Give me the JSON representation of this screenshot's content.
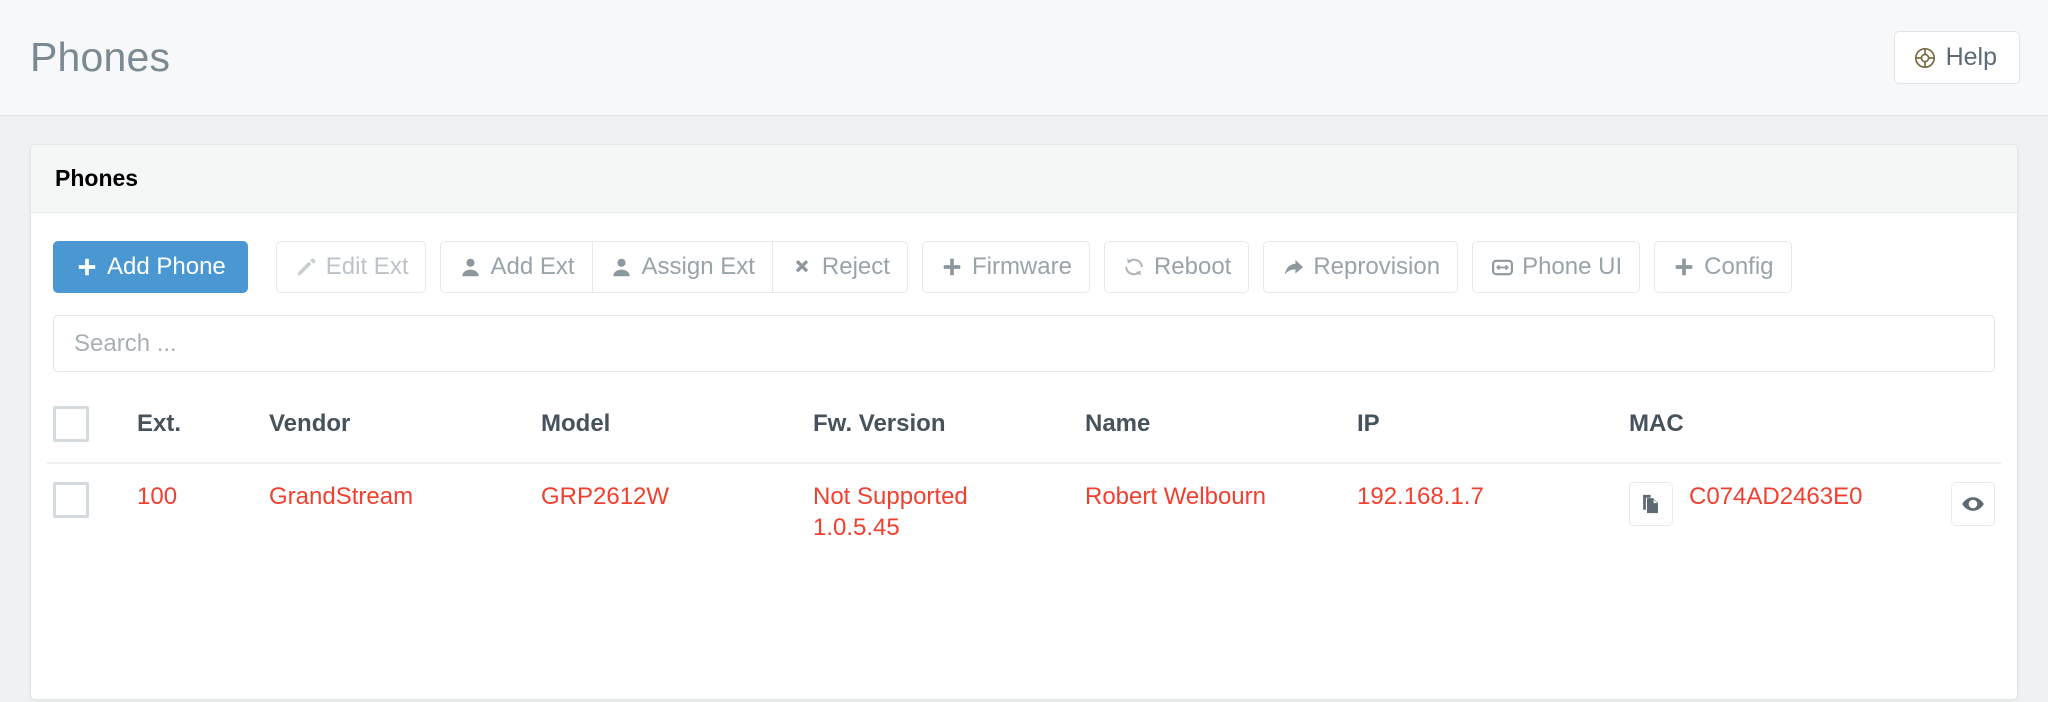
{
  "header": {
    "title": "Phones",
    "help_label": "Help",
    "help_icon": "lifering-icon"
  },
  "panel": {
    "title": "Phones"
  },
  "toolbar": {
    "buttons": [
      {
        "label": "Add Phone",
        "icon": "plus-icon",
        "style": "primary"
      },
      {
        "label": "Edit Ext",
        "icon": "pencil-icon",
        "style": "muted"
      },
      {
        "label": "Add Ext",
        "icon": "user-icon",
        "style": "default"
      },
      {
        "label": "Assign Ext",
        "icon": "user-icon",
        "style": "default"
      },
      {
        "label": "Reject",
        "icon": "times-icon",
        "style": "default"
      },
      {
        "label": "Firmware",
        "icon": "plus-icon",
        "style": "default"
      },
      {
        "label": "Reboot",
        "icon": "refresh-icon",
        "style": "default"
      },
      {
        "label": "Reprovision",
        "icon": "share-icon",
        "style": "default"
      },
      {
        "label": "Phone UI",
        "icon": "display-icon",
        "style": "default"
      },
      {
        "label": "Config",
        "icon": "plus-icon",
        "style": "default"
      }
    ]
  },
  "search": {
    "placeholder": "Search ...",
    "value": ""
  },
  "table": {
    "columns": [
      "Ext.",
      "Vendor",
      "Model",
      "Fw. Version",
      "Name",
      "IP",
      "MAC"
    ],
    "rows": [
      {
        "ext": "100",
        "vendor": "GrandStream",
        "model": "GRP2612W",
        "fw_version_line1": "Not Supported",
        "fw_version_line2": "1.0.5.45",
        "name": "Robert Welbourn",
        "ip": "192.168.1.7",
        "mac": "C074AD2463E0",
        "copy_icon": "copy-icon",
        "view_icon": "eye-icon"
      }
    ]
  },
  "colors": {
    "primary_blue": "#4a97d2",
    "row_text_red": "#f04030",
    "header_text": "#46525c",
    "page_title": "#7b8a92",
    "help_icon": "#7a6a43"
  }
}
